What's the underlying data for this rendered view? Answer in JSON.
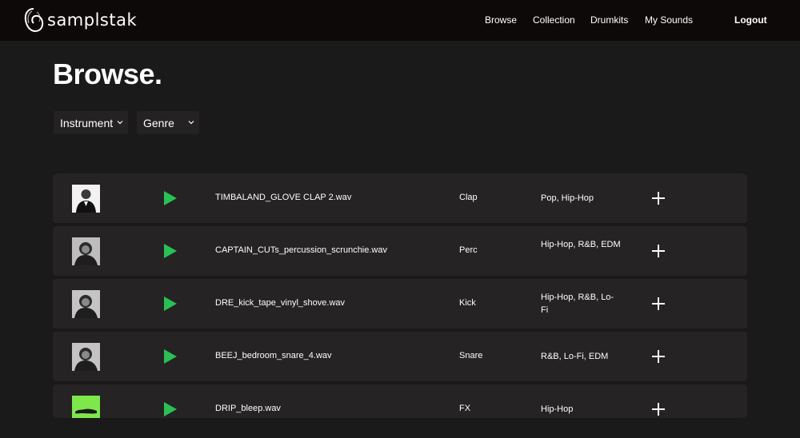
{
  "brand": {
    "name": "samplstak"
  },
  "nav": {
    "browse": "Browse",
    "collection": "Collection",
    "drumkits": "Drumkits",
    "my_sounds": "My Sounds",
    "logout": "Logout"
  },
  "page": {
    "title": "Browse."
  },
  "filters": {
    "instrument": "Instrument",
    "genre": "Genre"
  },
  "colors": {
    "play": "#26c254",
    "background": "#1b1a1a",
    "row": "#252323",
    "navbar": "#0d0909"
  },
  "samples": [
    {
      "filename": "TIMBALAND_GLOVE CLAP 2.wav",
      "category": "Clap",
      "genres": "Pop, Hip-Hop",
      "thumb_icon": "artist-photo-thumbnail"
    },
    {
      "filename": "CAPTAIN_CUTs_percussion_scrunchie.wav",
      "category": "Perc",
      "genres": "Hip-Hop, R&B, EDM",
      "thumb_icon": "artist-photo-thumbnail"
    },
    {
      "filename": "DRE_kick_tape_vinyl_shove.wav",
      "category": "Kick",
      "genres": "Hip-Hop, R&B, Lo-Fi",
      "thumb_icon": "artist-photo-thumbnail"
    },
    {
      "filename": "BEEJ_bedroom_snare_4.wav",
      "category": "Snare",
      "genres": "R&B, Lo-Fi, EDM",
      "thumb_icon": "artist-photo-thumbnail"
    },
    {
      "filename": "DRIP_bleep.wav",
      "category": "FX",
      "genres": "Hip-Hop",
      "thumb_icon": "green-artwork-thumbnail"
    }
  ]
}
